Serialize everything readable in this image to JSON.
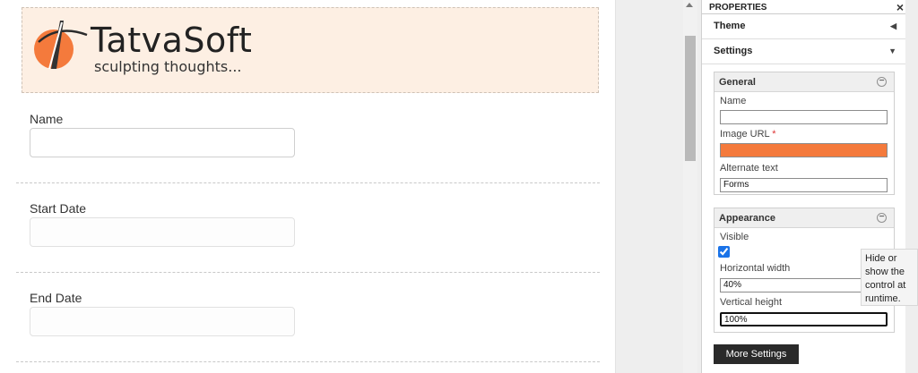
{
  "logo": {
    "wordmark": "TatvaSoft",
    "tagline": "sculpting thoughts..."
  },
  "form": {
    "fields": [
      {
        "label": "Name"
      },
      {
        "label": "Start Date"
      },
      {
        "label": "End Date"
      }
    ]
  },
  "panel": {
    "title": "PROPERTIES",
    "close": "×",
    "sections": {
      "theme": "Theme",
      "settings": "Settings"
    },
    "general": {
      "title": "General",
      "name_label": "Name",
      "name_value": "",
      "image_url_label": "Image URL",
      "required_mark": "*",
      "alt_label": "Alternate text",
      "alt_value": "Forms"
    },
    "appearance": {
      "title": "Appearance",
      "visible_label": "Visible",
      "visible_checked": true,
      "hwidth_label": "Horizontal width",
      "hwidth_value": "40%",
      "vheight_label": "Vertical height",
      "vheight_value": "100%"
    },
    "more_settings": "More Settings",
    "tooltip": "Hide or show the control at runtime."
  },
  "colors": {
    "accent_orange": "#f47a3c",
    "logo_bg": "#fdefe3",
    "button_dark": "#2a2a2a"
  }
}
